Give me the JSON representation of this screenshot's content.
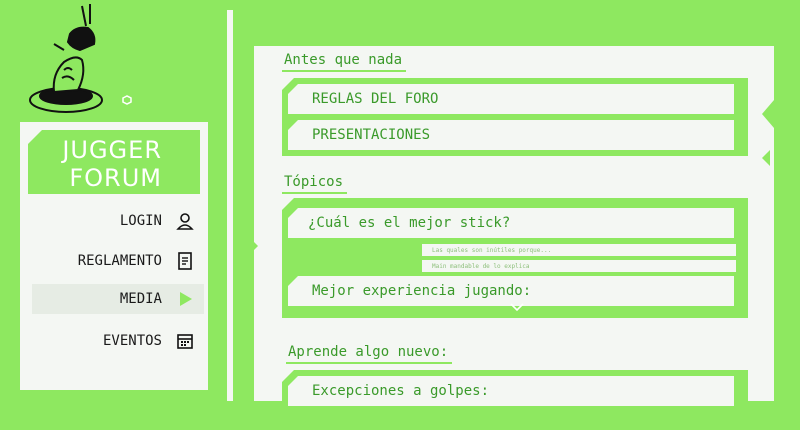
{
  "brand": {
    "line1": "JUGGER",
    "line2": "FORUM"
  },
  "nav": [
    {
      "label": "LOGIN",
      "icon": "user-icon"
    },
    {
      "label": "REGLAMENTO",
      "icon": "document-icon"
    },
    {
      "label": "MEDIA",
      "icon": "play-icon"
    },
    {
      "label": "EVENTOS",
      "icon": "calendar-icon"
    }
  ],
  "sections": {
    "first": {
      "title": "Antes que nada",
      "items": [
        "REGLAS DEL FORO",
        "PRESENTACIONES"
      ]
    },
    "topics": {
      "title": "Tópicos",
      "topic1": "¿Cuál es el mejor stick?",
      "reply1": "Las quales son inútiles porque...",
      "reply2": "Main mandable de lo explica",
      "topic2": "Mejor experiencia jugando:"
    },
    "learn": {
      "title": "Aprende algo nuevo:",
      "item1": "Excepciones a golpes:"
    }
  },
  "colors": {
    "accent": "#8ee860",
    "panel": "#f4f7f3",
    "text_green": "#3a9a2a"
  }
}
